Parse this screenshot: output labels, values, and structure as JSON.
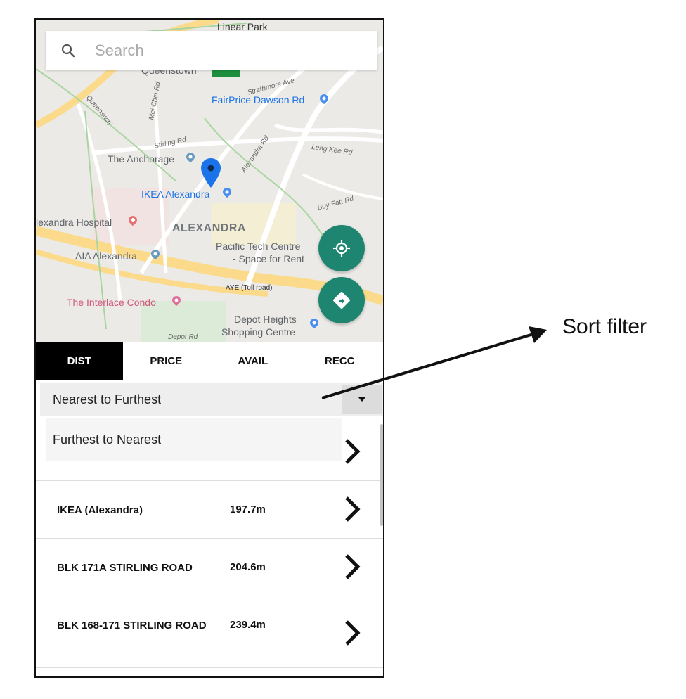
{
  "search": {
    "placeholder": "Search"
  },
  "map": {
    "labels": {
      "linear_park": "Linear Park",
      "queenstown": "Queenstown",
      "strathmore": "Strathmore Ave",
      "fairprice": "FairPrice Dawson Rd",
      "queensway": "Queensway",
      "mei_chin": "Mei Chin Rd",
      "stirling": "Stirling Rd",
      "leng_kee": "Leng Kee Rd",
      "anchorage": "The Anchorage",
      "alexandra_rd": "Alexandra Rd",
      "ikea": "IKEA Alexandra",
      "jalan_kilang": "Boy Fatt Rd",
      "hospital": "lexandra Hospital",
      "alexandra": "ALEXANDRA",
      "pacific_tech_1": "Pacific Tech Centre",
      "pacific_tech_2": "- Space for Rent",
      "aia": "AIA Alexandra",
      "aye": "AYE (Toll road)",
      "interlace": "The Interlace Condo",
      "depot_1": "Depot Heights",
      "depot_2": "Shopping Centre",
      "depot_rd": "Depot Rd"
    },
    "colors": {
      "road": "#fbdb8b",
      "pin": "#1a73e8",
      "fab": "#1e8670"
    }
  },
  "tabs": [
    {
      "label": "DIST",
      "active": true
    },
    {
      "label": "PRICE",
      "active": false
    },
    {
      "label": "AVAIL",
      "active": false
    },
    {
      "label": "RECC",
      "active": false
    }
  ],
  "sort": {
    "selected": "Nearest to Furthest",
    "options": [
      "Nearest to Furthest",
      "Furthest to Nearest"
    ]
  },
  "results": [
    {
      "name": "IKEA (Alexandra)",
      "distance": "197.7m"
    },
    {
      "name": "BLK 171A STIRLING ROAD",
      "distance": "204.6m"
    },
    {
      "name": "BLK 168-171 STIRLING ROAD",
      "distance": "239.4m"
    }
  ],
  "annotation": {
    "label": "Sort filter"
  }
}
